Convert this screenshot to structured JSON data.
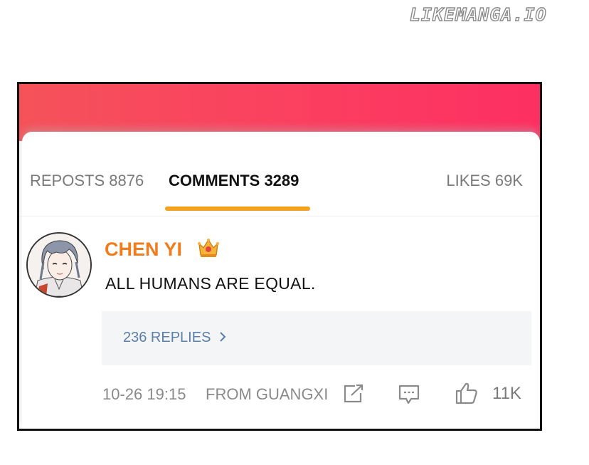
{
  "watermark": "LIKEMANGA.IO",
  "tabs": {
    "reposts": "REPOSTS 8876",
    "comments": "COMMENTS 3289",
    "likes": "LIKES 69K"
  },
  "comment": {
    "username": "CHEN YI",
    "text": "ALL HUMANS ARE EQUAL.",
    "replies_link": "236 REPLIES",
    "timestamp": "10-26 19:15",
    "location": "FROM GUANGXI",
    "like_count": "11K"
  },
  "icons": {
    "badge": "crown-icon",
    "share": "share-icon",
    "comment": "comment-icon",
    "like": "thumbs-up-icon",
    "replies_arrow": "chevron-right-icon"
  },
  "colors": {
    "header_gradient_start": "#f5525a",
    "header_gradient_end": "#fd2f62",
    "tab_underline": "#f3a21d",
    "username": "#ef7d1e",
    "replies_link": "#5b7fa8"
  }
}
